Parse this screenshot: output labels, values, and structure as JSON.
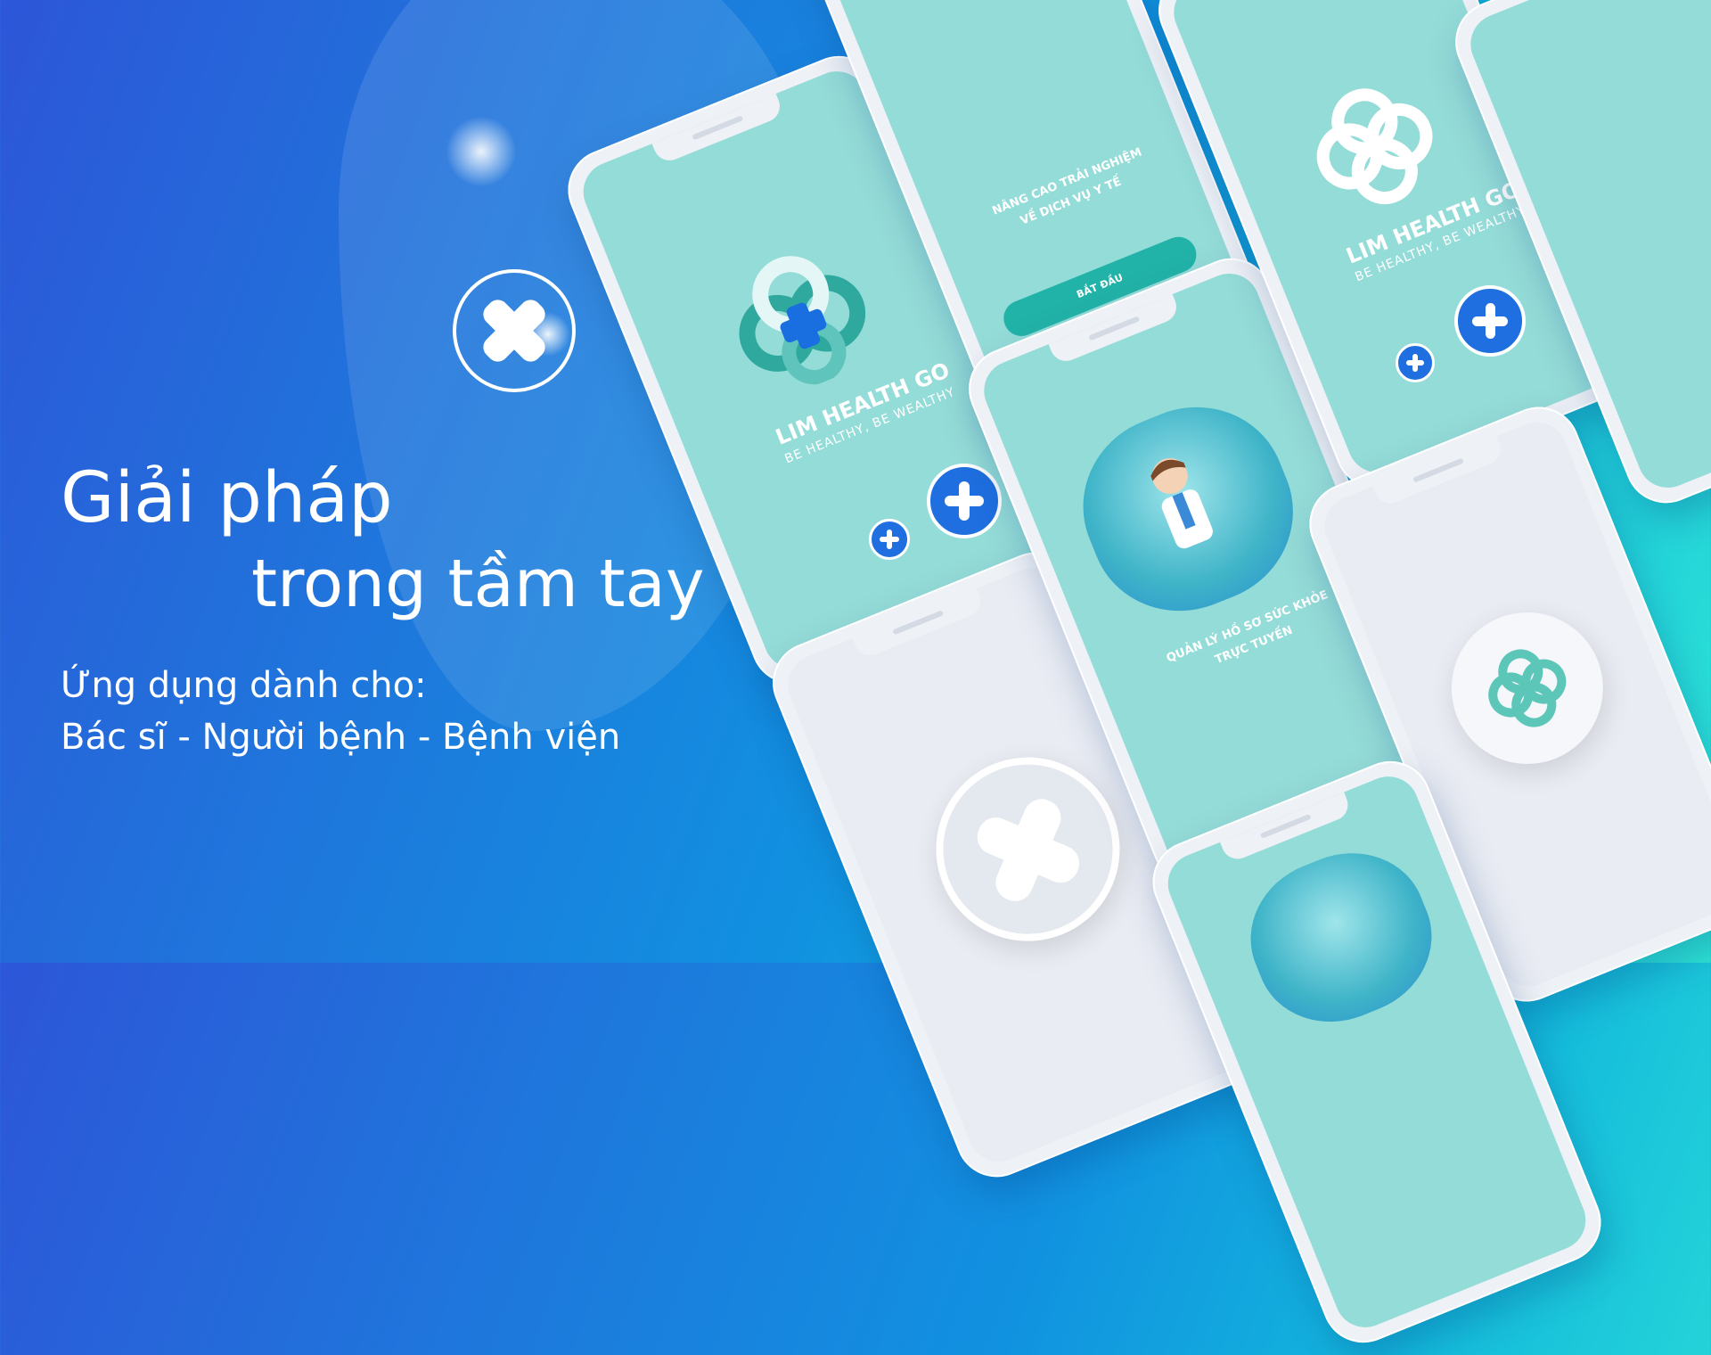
{
  "hero": {
    "line1": "Giải pháp",
    "line2": "trong tầm tay",
    "line3": "Ứng dụng dành cho:",
    "line4": "Bác sĩ - Người bệnh - Bệnh viện"
  },
  "phones": {
    "splash_a": {
      "title": "LIM HEALTH GO",
      "subtitle": "BE HEALTHY, BE WEALTHY"
    },
    "splash_b": {
      "title": "LIM HEALTH GO",
      "subtitle": "BE HEALTHY, BE WEALTHY"
    },
    "onboarding_top": {
      "heading_1": "NÂNG CAO TRẢI NGHIỆM",
      "heading_2": "VỀ DỊCH VỤ Y TẾ",
      "button": "BẮT ĐẦU"
    },
    "onboarding_mid": {
      "heading_1": "QUẢN LÝ HỒ SƠ SỨC KHỎE",
      "heading_2": "TRỰC TUYẾN"
    }
  },
  "colors": {
    "bg_start": "#2d56d8",
    "bg_end": "#2ee6d6",
    "screen_teal": "#94dcd8",
    "badge_blue": "#1f6fe0"
  }
}
